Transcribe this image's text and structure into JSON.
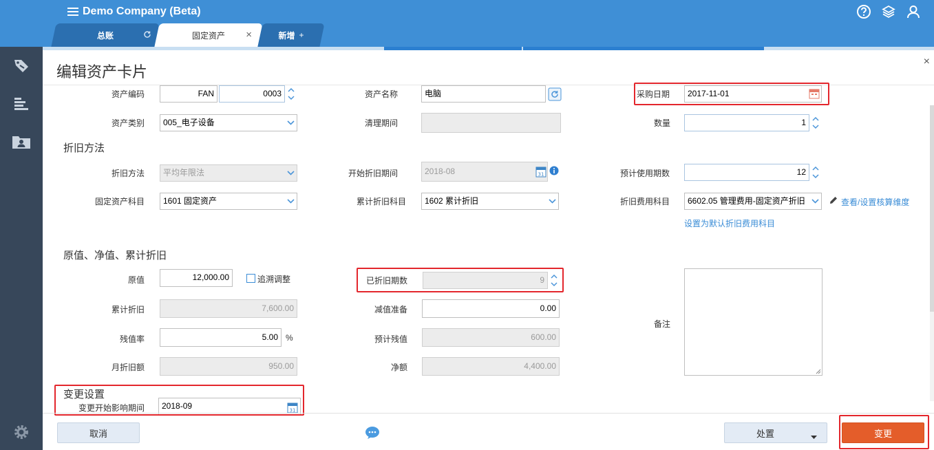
{
  "app": {
    "title": "Demo Company (Beta)"
  },
  "tabs": [
    {
      "label": "总账",
      "icon": "refresh-icon"
    },
    {
      "label": "固定资产",
      "icon": "close-icon",
      "close": "×"
    },
    {
      "label": "新增",
      "icon": "plus-icon",
      "plus": "+"
    }
  ],
  "header_icons": [
    "help-icon",
    "layers-icon",
    "user-icon"
  ],
  "sidebar_icons": [
    "tag-icon",
    "chart-bars-icon",
    "contact-folder-icon",
    "settings-icon"
  ],
  "page": {
    "title": "编辑资产卡片",
    "close": "×"
  },
  "fields": {
    "asset_code_label": "资产编码",
    "asset_code_prefix": "FAN",
    "asset_code_number": "0003",
    "asset_name_label": "资产名称",
    "asset_name_value": "电脑",
    "purchase_date_label": "采购日期",
    "purchase_date_value": "2017-11-01",
    "category_label": "资产类别",
    "category_value": "005_电子设备",
    "cleanup_period_label": "清理期间",
    "cleanup_period_value": "",
    "quantity_label": "数量",
    "quantity_value": "1"
  },
  "depreciation": {
    "section_title": "折旧方法",
    "method_label": "折旧方法",
    "method_value": "平均年限法",
    "start_period_label": "开始折旧期间",
    "start_period_value": "2018-08",
    "expected_periods_label": "预计使用期数",
    "expected_periods_value": "12",
    "asset_account_label": "固定资产科目",
    "asset_account_value": "1601 固定资产",
    "accum_account_label": "累计折旧科目",
    "accum_account_value": "1602 累计折旧",
    "expense_account_label": "折旧费用科目",
    "expense_account_value": "6602.05 管理费用-固定资产折旧",
    "view_dimensions_link": "查看/设置核算维度",
    "set_default_link": "设置为默认折旧费用科目"
  },
  "values": {
    "section_title": "原值、净值、累计折旧",
    "original_label": "原值",
    "original_value": "12,000.00",
    "retro_adjust_label": "追溯调整",
    "depreciated_periods_label": "已折旧期数",
    "depreciated_periods_value": "9",
    "notes_label": "备注",
    "accum_dep_label": "累计折旧",
    "accum_dep_value": "7,600.00",
    "impairment_label": "减值准备",
    "impairment_value": "0.00",
    "residual_rate_label": "残值率",
    "residual_rate_value": "5.00",
    "residual_rate_unit": "%",
    "expected_residual_label": "预计残值",
    "expected_residual_value": "600.00",
    "monthly_dep_label": "月折旧额",
    "monthly_dep_value": "950.00",
    "net_label": "净额",
    "net_value": "4,400.00"
  },
  "change": {
    "section_title": "变更设置",
    "start_period_label": "变更开始影响期间",
    "start_period_value": "2018-09"
  },
  "footer": {
    "cancel_label": "取消",
    "dispose_label": "处置",
    "change_label": "变更"
  },
  "colors": {
    "header": "#3f8fd6",
    "sidebar": "#37475a",
    "accent": "#e45d2a",
    "highlight": "#e3262c",
    "link": "#3a8cd6"
  }
}
